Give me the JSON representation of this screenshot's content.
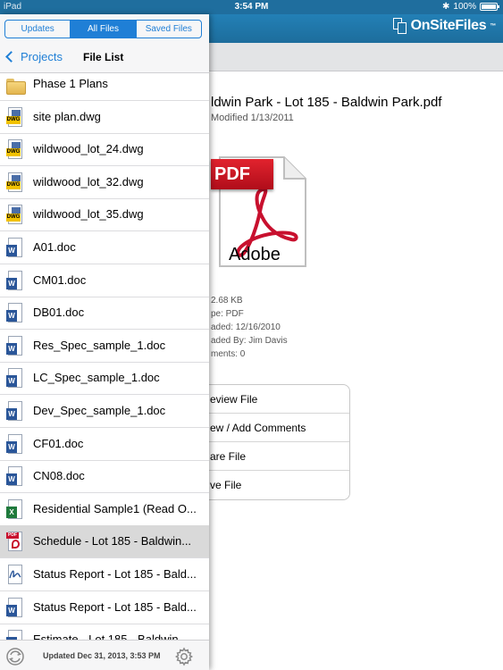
{
  "status": {
    "left": "iPad",
    "time": "3:54 PM",
    "battery": "100%"
  },
  "brand": {
    "name": "OnSiteFiles",
    "tm": "™"
  },
  "segments": [
    {
      "label": "Updates",
      "active": false
    },
    {
      "label": "All Files",
      "active": true
    },
    {
      "label": "Saved Files",
      "active": false
    }
  ],
  "nav": {
    "back_label": "Projects",
    "title": "File List"
  },
  "files": [
    {
      "name": "Phase 1 Plans",
      "type": "folder",
      "icon": "folder-icon"
    },
    {
      "name": "site plan.dwg",
      "type": "dwg",
      "icon": "dwg-file-icon"
    },
    {
      "name": "wildwood_lot_24.dwg",
      "type": "dwg",
      "icon": "dwg-file-icon"
    },
    {
      "name": "wildwood_lot_32.dwg",
      "type": "dwg",
      "icon": "dwg-file-icon"
    },
    {
      "name": "wildwood_lot_35.dwg",
      "type": "dwg",
      "icon": "dwg-file-icon"
    },
    {
      "name": "A01.doc",
      "type": "word",
      "icon": "word-file-icon"
    },
    {
      "name": "CM01.doc",
      "type": "word",
      "icon": "word-file-icon"
    },
    {
      "name": "DB01.doc",
      "type": "word",
      "icon": "word-file-icon"
    },
    {
      "name": "Res_Spec_sample_1.doc",
      "type": "word",
      "icon": "word-file-icon"
    },
    {
      "name": "LC_Spec_sample_1.doc",
      "type": "word",
      "icon": "word-file-icon"
    },
    {
      "name": "Dev_Spec_sample_1.doc",
      "type": "word",
      "icon": "word-file-icon"
    },
    {
      "name": "CF01.doc",
      "type": "word",
      "icon": "word-file-icon"
    },
    {
      "name": "CN08.doc",
      "type": "word",
      "icon": "word-file-icon"
    },
    {
      "name": "Residential Sample1 (Read O...",
      "type": "excel",
      "icon": "excel-file-icon"
    },
    {
      "name": "Schedule - Lot 185 - Baldwin...",
      "type": "pdf",
      "icon": "pdf-file-icon",
      "selected": true
    },
    {
      "name": "Status Report - Lot 185 - Bald...",
      "type": "sig",
      "icon": "signature-file-icon"
    },
    {
      "name": "Status Report - Lot 185 - Bald...",
      "type": "word",
      "icon": "word-file-icon"
    },
    {
      "name": "Estimate - Lot 185 - Baldwin...",
      "type": "word",
      "icon": "word-file-icon"
    }
  ],
  "bottom": {
    "updated": "Updated Dec 31, 2013, 3:53 PM"
  },
  "detail": {
    "title": "ldwin Park - Lot 185 - Baldwin Park.pdf",
    "modified": "Modified 1/13/2011",
    "pdf_badge": "PDF",
    "pdf_brand": "Adobe",
    "info": [
      "2.68 KB",
      "pe:  PDF",
      "aded:  12/16/2010",
      "aded By:  Jim Davis",
      "ments:  0"
    ],
    "actions": [
      "eview File",
      "ew / Add Comments",
      "are File",
      "ve File"
    ]
  },
  "colors": {
    "accent": "#1f7fd6",
    "header": "#1f6e9e",
    "pdf_red": "#c8102e"
  }
}
